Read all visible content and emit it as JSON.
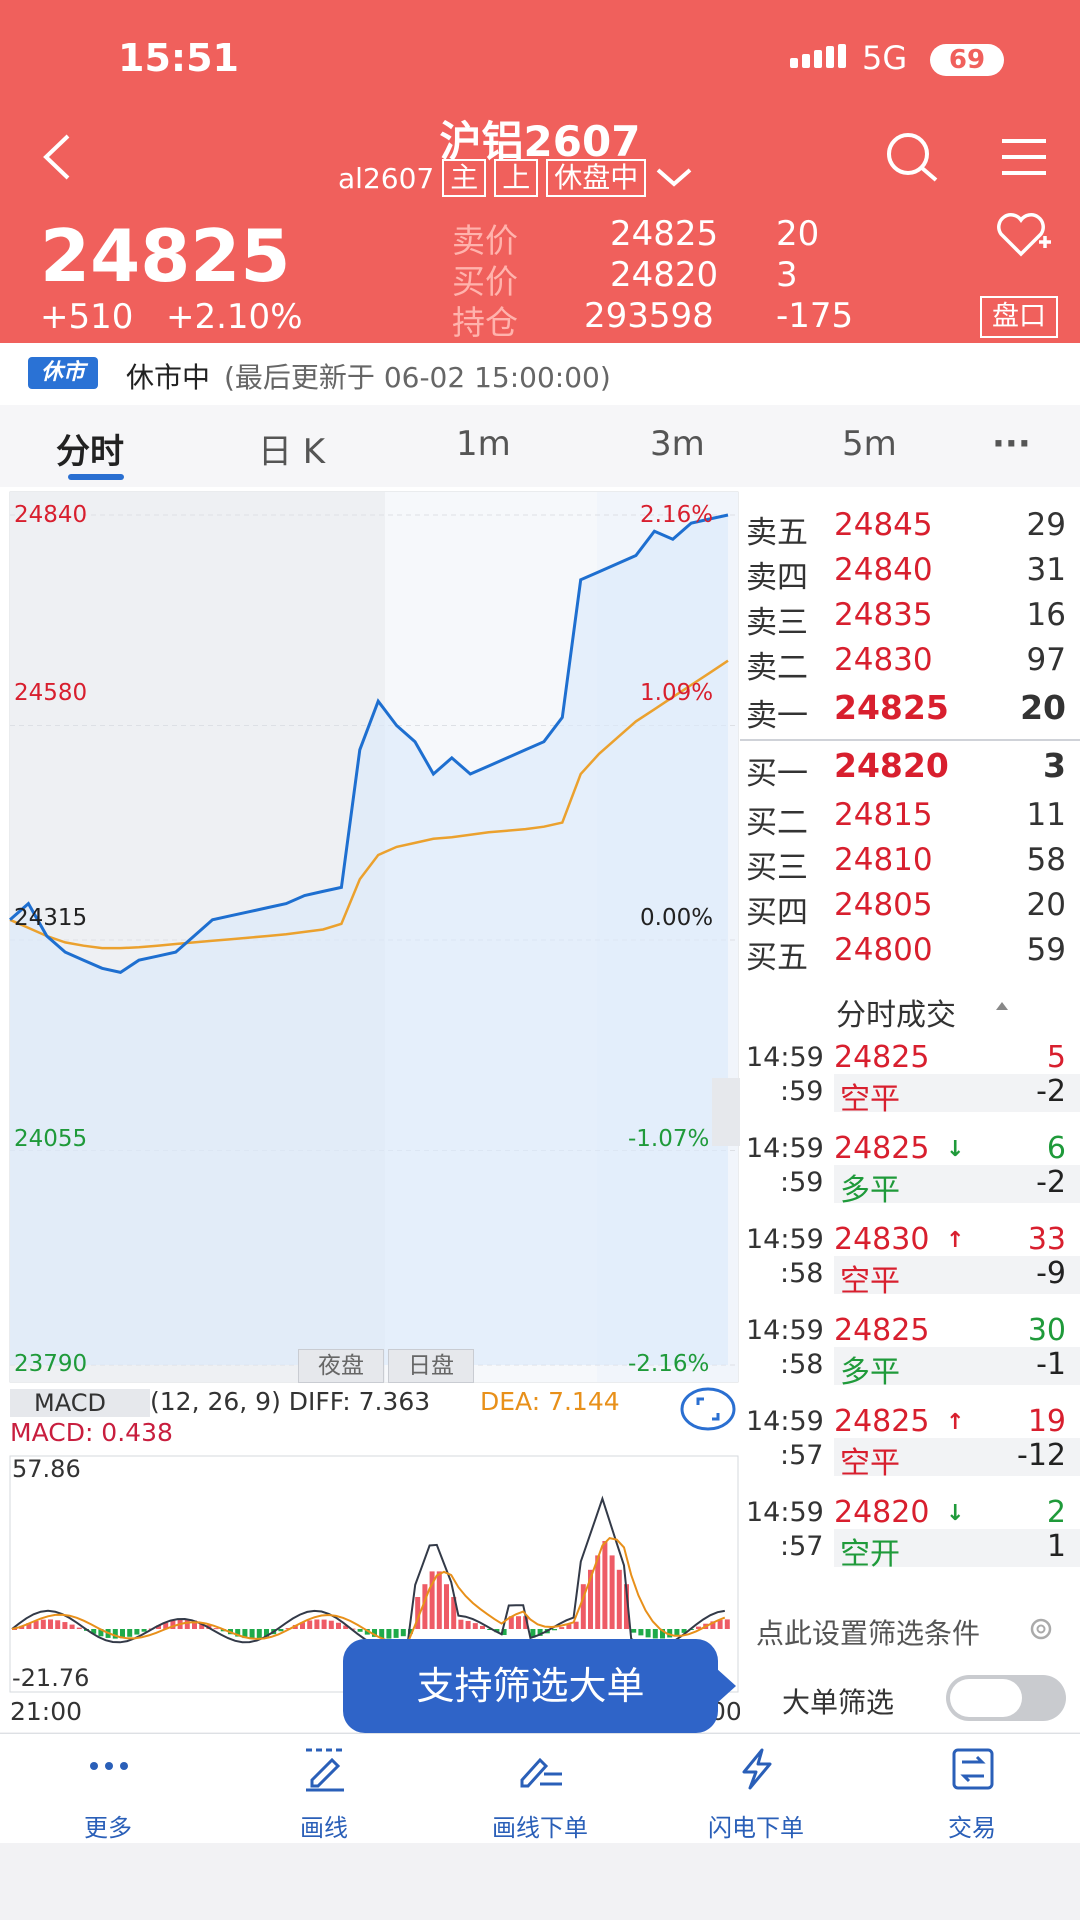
{
  "status": {
    "time": "15:51",
    "network": "5G",
    "battery": "69"
  },
  "header": {
    "title": "沪铝2607",
    "code": "al2607",
    "tags": [
      "主",
      "上",
      "休盘中"
    ],
    "last_price": "24825",
    "change": "+510",
    "change_pct": "+2.10%",
    "quote_rows": [
      {
        "label": "卖价",
        "value": "24825",
        "vol": "20"
      },
      {
        "label": "买价",
        "value": "24820",
        "vol": "3"
      },
      {
        "label": "持仓",
        "value": "293598",
        "vol": "-175"
      }
    ],
    "pankou_label": "盘口"
  },
  "notice": {
    "badge": "休市",
    "state": "休市中",
    "updated": "(最后更新于 06-02 15:00:00)"
  },
  "tabs": [
    "分时",
    "日 K",
    "1m",
    "3m",
    "5m",
    "···"
  ],
  "chart": {
    "y_left": [
      "24840",
      "24580",
      "24315",
      "24055",
      "23790"
    ],
    "y_right": [
      "2.16%",
      "1.09%",
      "0.00%",
      "-1.07%",
      "-2.16%"
    ],
    "session_buttons": [
      "夜盘",
      "日盘"
    ],
    "macd": {
      "name": "MACD",
      "params": "(12, 26, 9) DIFF: 7.363",
      "dea": "DEA: 7.144",
      "value": "MACD: 0.438",
      "max": "57.86",
      "min": "-21.76"
    },
    "time_start": "21:00",
    "time_end": "00",
    "tooltip": "支持筛选大单"
  },
  "chart_data": {
    "type": "line",
    "title": "",
    "ylim": [
      23790,
      24840
    ],
    "prev_close": 24315,
    "series": [
      {
        "values": [
          24340,
          24360,
          24320,
          24300,
          24290,
          24280,
          24275,
          24290,
          24295,
          24300,
          24320,
          24340,
          24345,
          24350,
          24355,
          24360,
          24370,
          24375,
          24380,
          24550,
          24610,
          24580,
          24560,
          24520,
          24540,
          24520,
          24530,
          24540,
          24550,
          24560,
          24590,
          24760,
          24770,
          24780,
          24790,
          24820,
          24810,
          24830,
          24835,
          24840
        ]
      },
      {
        "values": [
          24340,
          24330,
          24320,
          24312,
          24308,
          24305,
          24305,
          24306,
          24308,
          24310,
          24312,
          24314,
          24316,
          24318,
          24320,
          24322,
          24325,
          24328,
          24335,
          24390,
          24420,
          24430,
          24435,
          24440,
          24442,
          24445,
          24448,
          24450,
          24452,
          24455,
          24460,
          24520,
          24545,
          24565,
          24585,
          24600,
          24615,
          24630,
          24645,
          24660
        ]
      }
    ]
  },
  "order_book": {
    "asks": [
      {
        "label": "卖五",
        "price": "24845",
        "vol": "29"
      },
      {
        "label": "卖四",
        "price": "24840",
        "vol": "31"
      },
      {
        "label": "卖三",
        "price": "24835",
        "vol": "16"
      },
      {
        "label": "卖二",
        "price": "24830",
        "vol": "97"
      },
      {
        "label": "卖一",
        "price": "24825",
        "vol": "20"
      }
    ],
    "bids": [
      {
        "label": "买一",
        "price": "24820",
        "vol": "3"
      },
      {
        "label": "买二",
        "price": "24815",
        "vol": "11"
      },
      {
        "label": "买三",
        "price": "24810",
        "vol": "58"
      },
      {
        "label": "买四",
        "price": "24805",
        "vol": "20"
      },
      {
        "label": "买五",
        "price": "24800",
        "vol": "59"
      }
    ]
  },
  "trades": {
    "title": "分时成交",
    "rows": [
      {
        "time": "14:59",
        "sec": ":59",
        "price": "24825",
        "arrow": "",
        "vol": "5",
        "vol_color": "#d81f2e",
        "type": "空平",
        "type_color": "#d81f2e",
        "chg": "-2"
      },
      {
        "time": "14:59",
        "sec": ":59",
        "price": "24825",
        "arrow": "↓",
        "arrow_color": "#1f9a3a",
        "vol": "6",
        "vol_color": "#1f9a3a",
        "type": "多平",
        "type_color": "#1f9a3a",
        "chg": "-2"
      },
      {
        "time": "14:59",
        "sec": ":58",
        "price": "24830",
        "arrow": "↑",
        "arrow_color": "#d81f2e",
        "vol": "33",
        "vol_color": "#d81f2e",
        "type": "空平",
        "type_color": "#d81f2e",
        "chg": "-9"
      },
      {
        "time": "14:59",
        "sec": ":58",
        "price": "24825",
        "arrow": "",
        "vol": "30",
        "vol_color": "#1f9a3a",
        "type": "多平",
        "type_color": "#1f9a3a",
        "chg": "-1"
      },
      {
        "time": "14:59",
        "sec": ":57",
        "price": "24825",
        "arrow": "↑",
        "arrow_color": "#d81f2e",
        "vol": "19",
        "vol_color": "#d81f2e",
        "type": "空平",
        "type_color": "#d81f2e",
        "chg": "-12"
      },
      {
        "time": "14:59",
        "sec": ":57",
        "price": "24820",
        "arrow": "↓",
        "arrow_color": "#1f9a3a",
        "vol": "2",
        "vol_color": "#1f9a3a",
        "type": "空开",
        "type_color": "#1f9a3a",
        "chg": "1"
      }
    ],
    "filter_hint": "点此设置筛选条件",
    "big_order_label": "大单筛选"
  },
  "bottom_nav": [
    "更多",
    "画线",
    "画线下单",
    "闪电下单",
    "交易"
  ],
  "colors": {
    "header_bg": "#f0605c",
    "up": "#d81f2e",
    "down": "#1f9a3a",
    "price_line": "#1e6fd0",
    "avg_line": "#eba12e",
    "accent": "#2a6fd1"
  }
}
